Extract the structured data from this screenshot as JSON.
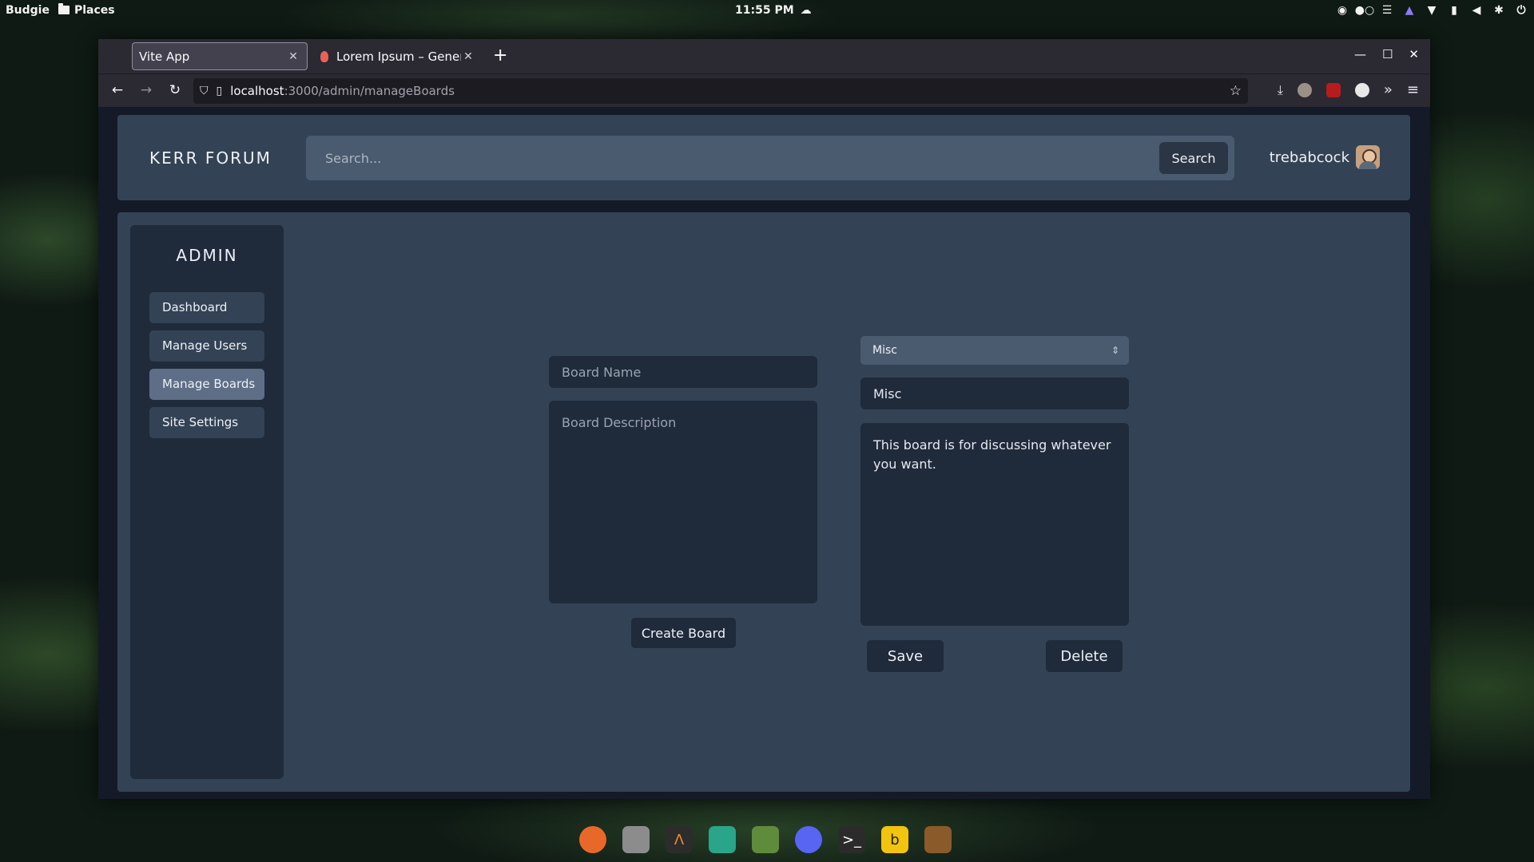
{
  "system_panel": {
    "menu_label": "Budgie",
    "places_label": "Places",
    "clock": "11:55 PM",
    "weather_icon": "cloud-icon",
    "tray_icons": [
      "discord-icon",
      "dots-icon",
      "menu-icon",
      "bell-icon",
      "wifi-icon",
      "battery-icon",
      "volume-icon",
      "bluetooth-icon",
      "power-icon"
    ]
  },
  "browser": {
    "tabs": [
      {
        "title": "Vite App",
        "active": true
      },
      {
        "title": "Lorem Ipsum – Generat",
        "active": false
      }
    ],
    "url_host": "localhost",
    "url_path": ":3000/admin/manageBoards"
  },
  "header": {
    "logo": "KERR FORUM",
    "search_placeholder": "Search...",
    "search_button": "Search",
    "username": "trebabcock"
  },
  "sidebar": {
    "title": "ADMIN",
    "items": [
      {
        "label": "Dashboard",
        "active": false
      },
      {
        "label": "Manage Users",
        "active": false
      },
      {
        "label": "Manage Boards",
        "active": true
      },
      {
        "label": "Site Settings",
        "active": false
      }
    ]
  },
  "create_form": {
    "name_placeholder": "Board Name",
    "description_placeholder": "Board Description",
    "create_button": "Create Board"
  },
  "edit_form": {
    "selected_board": "Misc",
    "name_value": "Misc",
    "description_value": "This board is for discussing whatever you want.",
    "save_button": "Save",
    "delete_button": "Delete"
  },
  "dock": {
    "apps": [
      "firefox-icon",
      "files-icon",
      "sublime-text-icon",
      "keepass-icon",
      "minecraft-icon",
      "discord-icon",
      "terminal-icon",
      "bitwarden-icon",
      "minecraft-launcher-icon"
    ]
  }
}
